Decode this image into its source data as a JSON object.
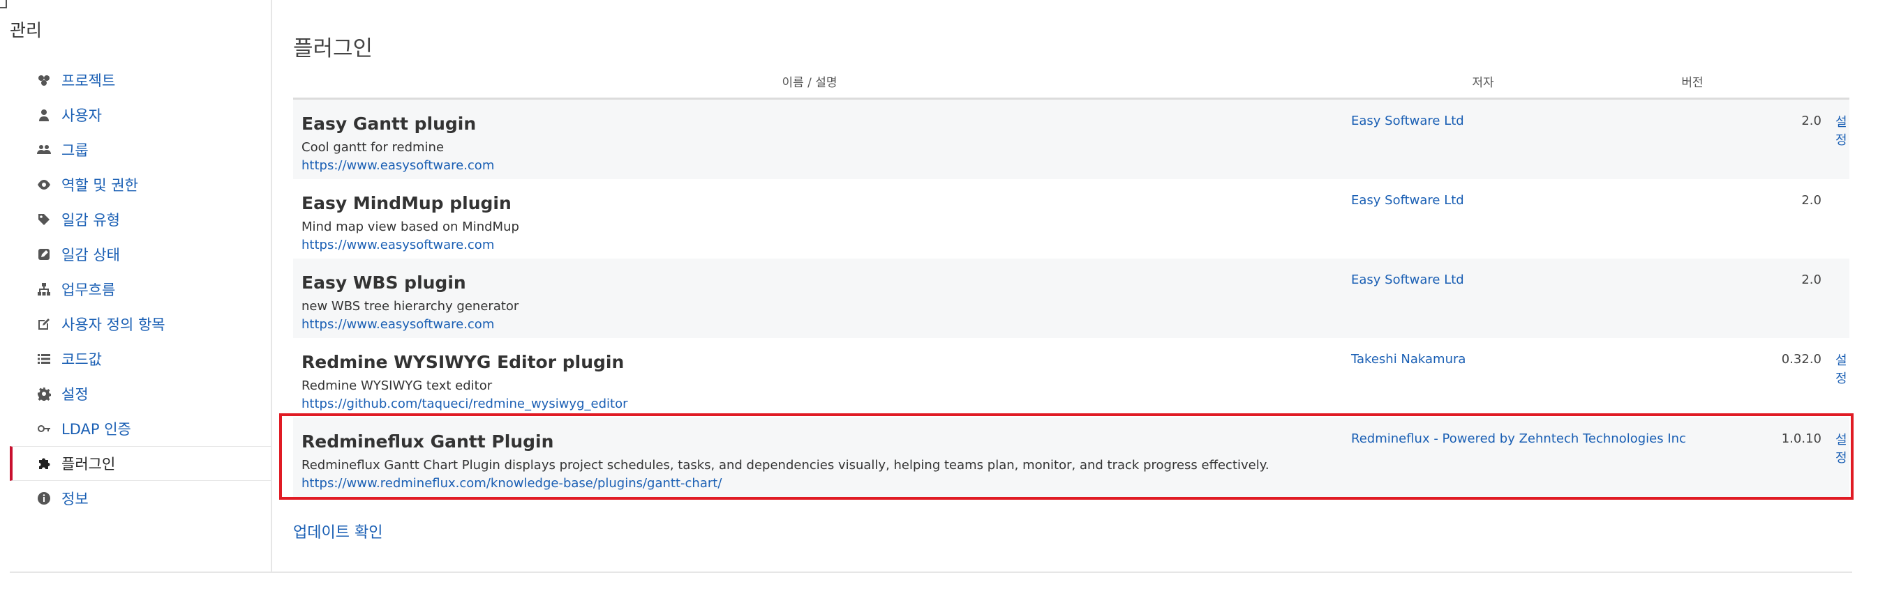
{
  "sidebar": {
    "title": "관리",
    "items": [
      {
        "label": "프로젝트",
        "icon": "projects-icon"
      },
      {
        "label": "사용자",
        "icon": "user-icon"
      },
      {
        "label": "그룹",
        "icon": "group-icon"
      },
      {
        "label": "역할 및 권한",
        "icon": "eye-icon"
      },
      {
        "label": "일감 유형",
        "icon": "tag-icon"
      },
      {
        "label": "일감 상태",
        "icon": "edit-square-icon"
      },
      {
        "label": "업무흐름",
        "icon": "sitemap-icon"
      },
      {
        "label": "사용자 정의 항목",
        "icon": "pencil-icon"
      },
      {
        "label": "코드값",
        "icon": "list-icon"
      },
      {
        "label": "설정",
        "icon": "gear-icon"
      },
      {
        "label": "LDAP 인증",
        "icon": "key-icon"
      },
      {
        "label": "플러그인",
        "icon": "puzzle-icon",
        "selected": true
      },
      {
        "label": "정보",
        "icon": "info-icon"
      }
    ]
  },
  "main": {
    "title": "플러그인",
    "table": {
      "headers": {
        "name": "이름 / 설명",
        "author": "저자",
        "version": "버전"
      },
      "rows": [
        {
          "name": "Easy Gantt plugin",
          "description": "Cool gantt for redmine",
          "url": "https://www.easysoftware.com",
          "author": "Easy Software Ltd",
          "version": "2.0",
          "config": "설정"
        },
        {
          "name": "Easy MindMup plugin",
          "description": "Mind map view based on MindMup",
          "url": "https://www.easysoftware.com",
          "author": "Easy Software Ltd",
          "version": "2.0",
          "config": ""
        },
        {
          "name": "Easy WBS plugin",
          "description": "new WBS tree hierarchy generator",
          "url": "https://www.easysoftware.com",
          "author": "Easy Software Ltd",
          "version": "2.0",
          "config": ""
        },
        {
          "name": "Redmine WYSIWYG Editor plugin",
          "description": "Redmine WYSIWYG text editor",
          "url": "https://github.com/taqueci/redmine_wysiwyg_editor",
          "author": "Takeshi Nakamura",
          "version": "0.32.0",
          "config": "설정"
        },
        {
          "name": "Redmineflux Gantt Plugin",
          "description": "Redmineflux Gantt Chart Plugin displays project schedules, tasks, and dependencies visually, helping teams plan, monitor, and track progress effectively.",
          "url": "https://www.redmineflux.com/knowledge-base/plugins/gantt-chart/",
          "author": "Redmineflux - Powered by Zehntech Technologies Inc",
          "version": "1.0.10",
          "config": "설정"
        }
      ]
    },
    "update_link": "업데이트 확인"
  },
  "colors": {
    "link": "#1a5fb4",
    "highlight": "#e01b24",
    "selected_marker": "#c8102e"
  }
}
